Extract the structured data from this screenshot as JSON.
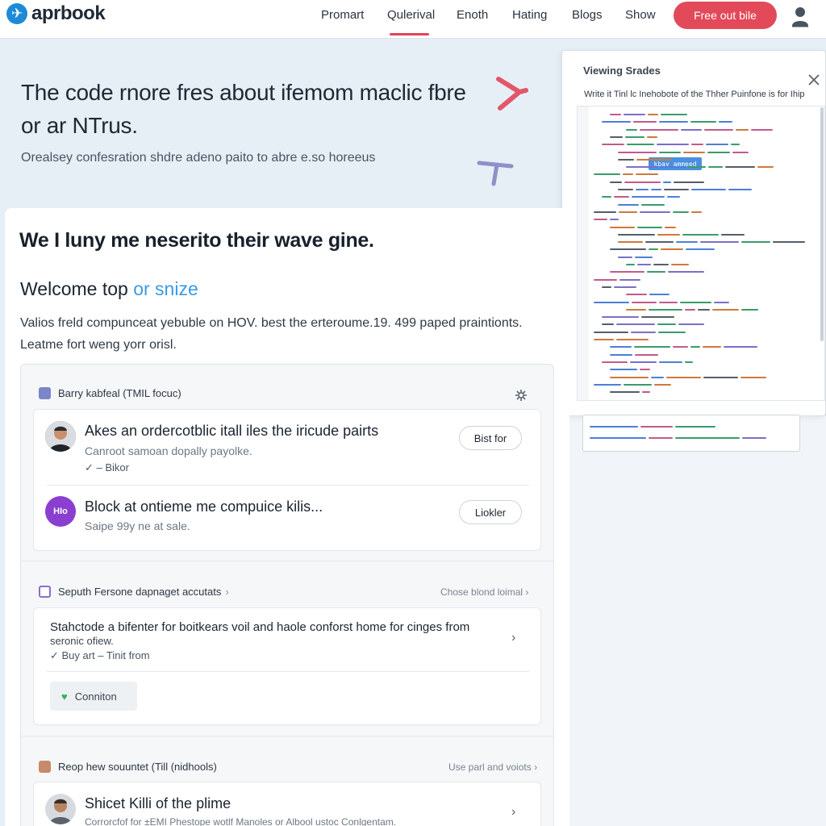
{
  "brand": {
    "name": "aprbook",
    "accent": "#e24959",
    "link": "#3a9ae4"
  },
  "nav": {
    "items": [
      "Promart",
      "Qulerival",
      "Enoth",
      "Hating",
      "Blogs",
      "Show"
    ],
    "active": "Qulerival",
    "cta_label": "Free out bile"
  },
  "hero": {
    "title": "The code rnore fres about ifemom maclic fbre or ar NTrus.",
    "subtitle": "Orealsey confesration shdre adeno paito to abre e.so horeeus"
  },
  "main": {
    "heading": "We I luny me neserito their wave gine.",
    "welcome_prefix": "Welcome top",
    "welcome_accent": "or snize",
    "intro": "Valios freld compunceat yebuble on HOV. best the erteroume.19. 499 paped praintionts. Leatme fort weng yorr orisl."
  },
  "sections": [
    {
      "header": "Barry kabfeal (TMIL focuc)",
      "rows": [
        {
          "title": "Akes an ordercotblic itall iles the iricude pairts",
          "subtitle": "Canroot samoan dopally payolke.",
          "tag": "✓ – Bikor",
          "button": "Bist for"
        },
        {
          "title": "Block at ontieme me compuice kilis...",
          "subtitle": "Saipe 99y ne at sale.",
          "avatar_text": "HIo",
          "button": "Liokler"
        }
      ]
    },
    {
      "header": "Seputh Fersone dapnaget accutats",
      "link": "Chose blond loimal",
      "rows": [
        {
          "title": "Stahctode a bifenter for boitkears voil and haole conforst home for cinges from",
          "subtitle": "seronic ofiew.",
          "tag": "✓ Buy art – Tinit from",
          "button": "Conniton"
        }
      ]
    },
    {
      "header": "Reop hew souuntet (Till (nidhools)",
      "link": "Use parl and voiots",
      "rows": [
        {
          "title": "Shicet Killi of the plime",
          "subtitle": "Corrorcfof for ±EMI Phestope wotlf Manoles or Albool ustoc Conlgentam."
        }
      ]
    }
  ],
  "code_panel": {
    "title": "Viewing Srades",
    "description": "Write it Tinl lc Inehobote of the Thher Puinfone is for Ihip",
    "selected_token": "kbay ammeed"
  },
  "icons": [
    "user-icon",
    "close-icon",
    "settings-icon",
    "chevron-right-icon",
    "heart-icon",
    "check-icon"
  ]
}
